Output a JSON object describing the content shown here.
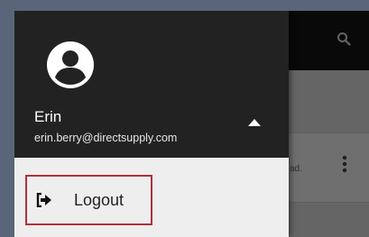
{
  "header": {
    "search_icon": "search-icon"
  },
  "list": {
    "row_snippet": "ad.",
    "more_icon": "more-vert-icon"
  },
  "drawer": {
    "avatar_icon": "account-circle-icon",
    "user": {
      "name": "Erin",
      "email": "erin.berry@directsupply.com"
    },
    "toggle_icon": "caret-up-icon",
    "menu": [
      {
        "label": "Logout",
        "icon": "sign-out-icon"
      }
    ]
  },
  "colors": {
    "drawer_header_bg": "#222222",
    "drawer_body_bg": "#eeeeee",
    "highlight_border": "#b0303a"
  }
}
